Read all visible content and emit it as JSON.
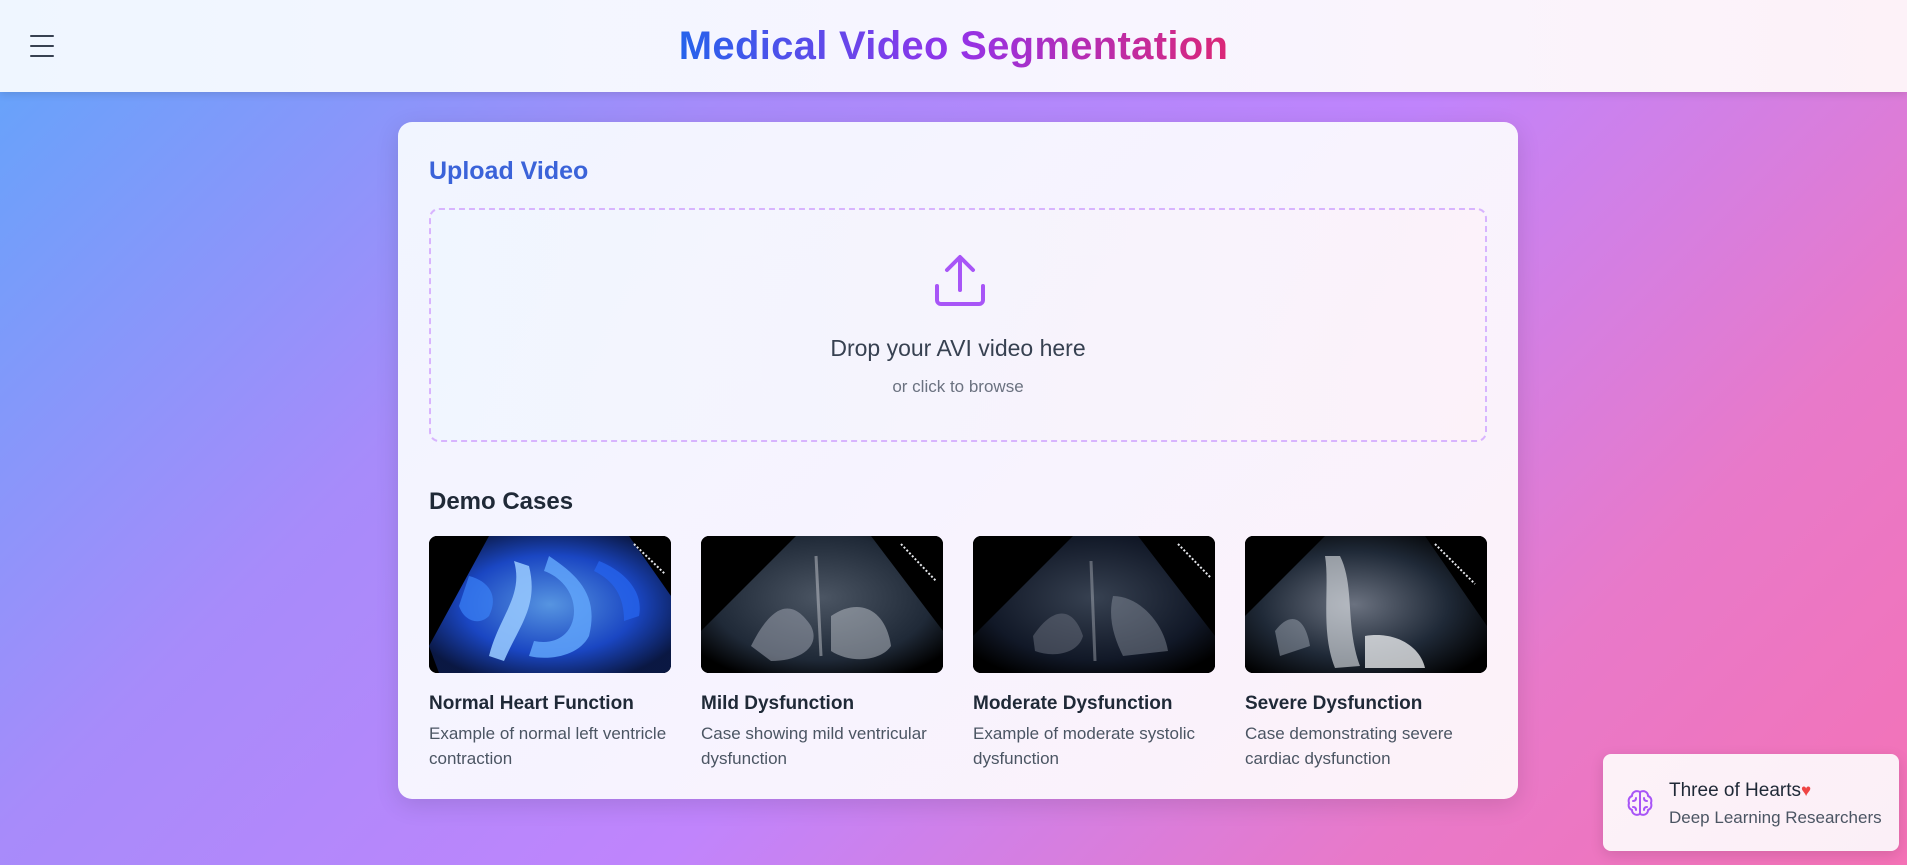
{
  "header": {
    "title": "Medical Video Segmentation",
    "menu_icon": "hamburger-menu-icon"
  },
  "upload": {
    "title": "Upload Video",
    "icon": "upload-icon",
    "drop_text": "Drop your AVI video here",
    "browse_text": "or click to browse"
  },
  "demo": {
    "title": "Demo Cases",
    "cases": [
      {
        "name": "Normal Heart Function",
        "description": "Example of normal left ventricle contraction"
      },
      {
        "name": "Mild Dysfunction",
        "description": "Case showing mild ventricular dysfunction"
      },
      {
        "name": "Moderate Dysfunction",
        "description": "Example of moderate systolic dysfunction"
      },
      {
        "name": "Severe Dysfunction",
        "description": "Case demonstrating severe cardiac dysfunction"
      }
    ]
  },
  "team": {
    "name": "Three of Hearts",
    "heart": "♥",
    "role": "Deep Learning Researchers",
    "icon": "brain-icon"
  },
  "colors": {
    "accent_blue": "#2563eb",
    "accent_purple": "#9333ea",
    "accent_pink": "#db2777",
    "upload_icon": "#a855f7"
  }
}
